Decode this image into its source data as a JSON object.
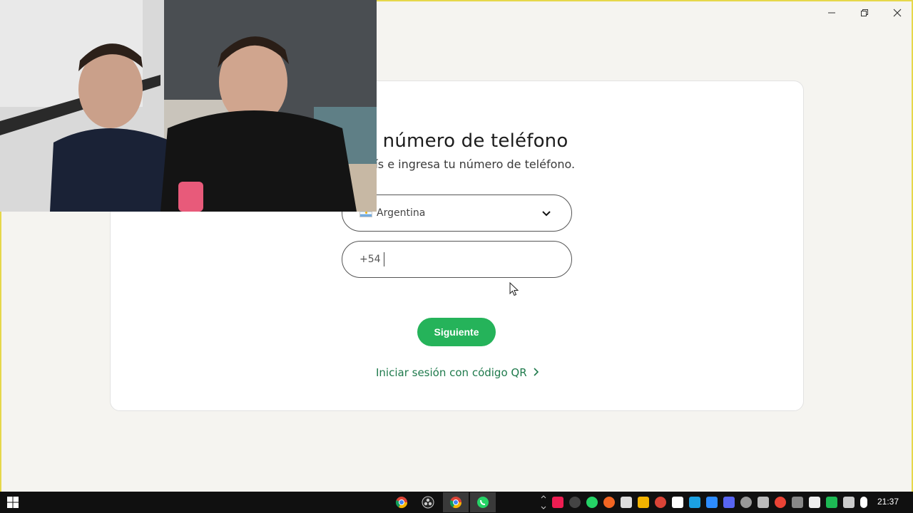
{
  "window": {
    "minimize_icon": "minimize-icon",
    "maximize_icon": "restore-icon",
    "close_icon": "close-icon"
  },
  "login": {
    "title": "a el número de teléfono",
    "subtitle": "un país e ingresa tu número de teléfono.",
    "country": {
      "selected": "Argentina",
      "flag_icon": "argentina-flag-icon"
    },
    "phone": {
      "prefix": "+54",
      "value": ""
    },
    "next_label": "Siguiente",
    "qr_link_label": "Iniciar sesión con código QR"
  },
  "colors": {
    "accent_green": "#25b35a",
    "link_green": "#1f7a4c",
    "frame_border": "#e6d84a"
  },
  "taskbar": {
    "apps": [
      "chrome-icon",
      "obs-icon",
      "chrome-icon",
      "whatsapp-icon"
    ],
    "tray": [
      "tiktok-icon",
      "obs-icon",
      "whatsapp-icon",
      "app-icon",
      "app-icon",
      "app-icon",
      "chrome-icon",
      "app-icon",
      "app-icon",
      "app-icon",
      "discord-icon",
      "app-icon",
      "app-icon",
      "network-icon",
      "app-icon",
      "display-icon",
      "shield-icon",
      "volume-icon",
      "mic-icon"
    ],
    "clock": "21:37"
  }
}
